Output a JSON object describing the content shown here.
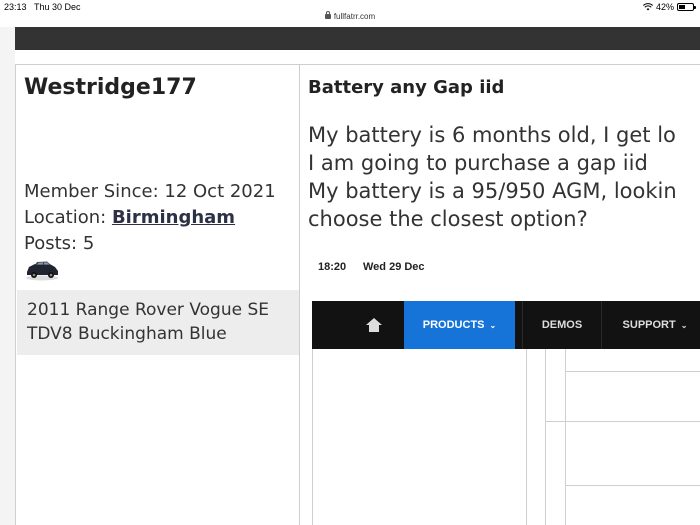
{
  "status_bar": {
    "time": "23:13",
    "date": "Thu 30 Dec",
    "battery_percent": "42%",
    "battery_level": 0.42
  },
  "browser": {
    "url": "fullfatrr.com"
  },
  "colors": {
    "topbar": "#333333",
    "link": "#2c3145",
    "signature_bg": "#ededed",
    "products_tab": "#1673d8"
  },
  "user": {
    "username": "Westridge177",
    "member_since_label": "Member Since:",
    "member_since": "12 Oct 2021",
    "location_label": "Location:",
    "location": "Birmingham",
    "posts_label": "Posts:",
    "posts": "5",
    "signature_line1": "2011 Range Rover Vogue SE",
    "signature_line2": "TDV8 Buckingham Blue"
  },
  "post": {
    "title": "Battery any Gap iid",
    "body_lines": [
      "My battery is 6 months old, I get lo",
      "I am going to purchase a gap iid",
      "My battery is a 95/950 AGM, lookin",
      "choose the closest option?"
    ]
  },
  "attachment": {
    "time": "18:20",
    "date": "Wed 29 Dec",
    "nav": {
      "home_icon": "home-icon",
      "products": "PRODUCTS",
      "demos": "DEMOS",
      "support": "SUPPORT"
    }
  }
}
